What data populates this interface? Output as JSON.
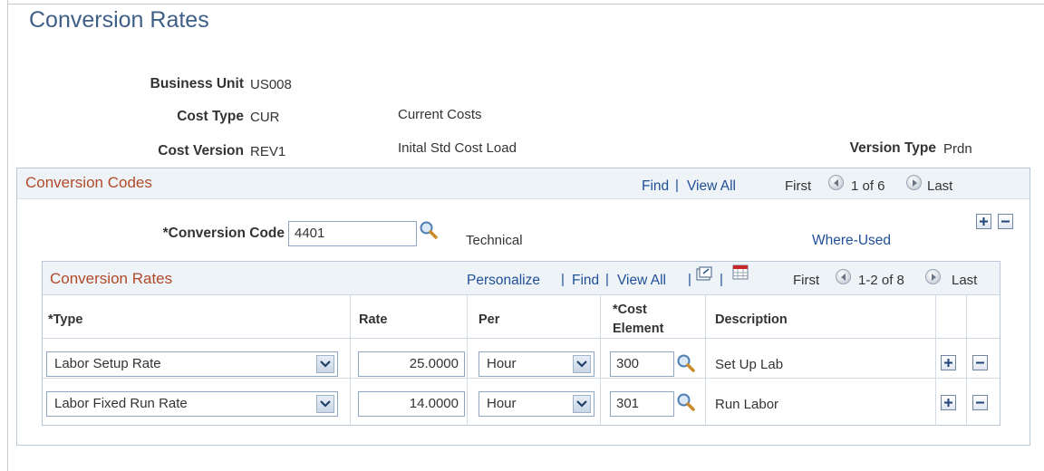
{
  "page_title": "Conversion Rates",
  "header": {
    "business_unit_label": "Business Unit",
    "business_unit_value": "US008",
    "cost_type_label": "Cost Type",
    "cost_type_value": "CUR",
    "cost_type_desc": "Current Costs",
    "cost_version_label": "Cost Version",
    "cost_version_value": "REV1",
    "cost_version_desc": "Inital Std Cost Load",
    "version_type_label": "Version Type",
    "version_type_value": "Prdn"
  },
  "codes_box": {
    "title": "Conversion Codes",
    "find": "Find",
    "view_all": "View All",
    "first": "First",
    "counter": "1 of 6",
    "last": "Last",
    "code_label": "*Conversion Code",
    "code_value": "4401",
    "code_desc": "Technical",
    "where_used": "Where-Used"
  },
  "rates_box": {
    "title": "Conversion Rates",
    "personalize": "Personalize",
    "find": "Find",
    "view_all": "View All",
    "first": "First",
    "counter": "1-2 of 8",
    "last": "Last",
    "columns": {
      "type": "*Type",
      "rate": "Rate",
      "per": "Per",
      "cost_element_1": "*Cost",
      "cost_element_2": "Element",
      "description": "Description"
    },
    "rows": [
      {
        "type": "Labor Setup Rate",
        "rate": "25.0000",
        "per": "Hour",
        "cost_element": "300",
        "description": "Set Up Lab"
      },
      {
        "type": "Labor Fixed Run Rate",
        "rate": "14.0000",
        "per": "Hour",
        "cost_element": "301",
        "description": "Run Labor"
      }
    ]
  },
  "icons": {
    "lookup": "magnifier-icon",
    "add": "plus-icon",
    "delete": "minus-icon",
    "prev": "arrow-left-icon",
    "next": "arrow-right-icon",
    "zoom": "zoom-grid-icon",
    "download": "download-grid-icon",
    "dropdown": "chevron-down-icon"
  },
  "colors": {
    "title": "#3f5f87",
    "box_title": "#b24a29",
    "link": "#1f4f96",
    "header_bg": "#eef3f8"
  }
}
